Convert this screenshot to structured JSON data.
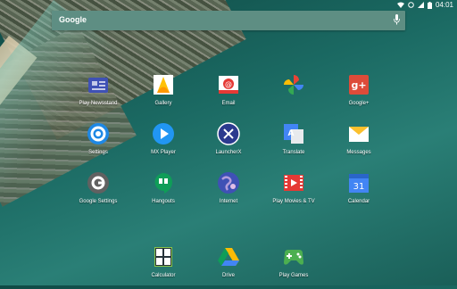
{
  "status_bar": {
    "time": "04:01"
  },
  "search": {
    "label": "Google"
  },
  "apps": [
    {
      "label": "Play Newsstand"
    },
    {
      "label": "Gallery"
    },
    {
      "label": "Email"
    },
    {
      "label": "Photos"
    },
    {
      "label": "Google+"
    },
    {
      "label": "Settings"
    },
    {
      "label": "MX Player"
    },
    {
      "label": "LauncherX"
    },
    {
      "label": "Translate"
    },
    {
      "label": "Messages"
    },
    {
      "label": "Google Settings"
    },
    {
      "label": "Hangouts"
    },
    {
      "label": "Internet"
    },
    {
      "label": "Play Movies & TV"
    },
    {
      "label": "Calendar"
    },
    {
      "label": "Calculator"
    },
    {
      "label": "Drive"
    },
    {
      "label": "Play Games"
    }
  ],
  "icon_text": {
    "email": "@",
    "gplus": "g+",
    "translate_a": "A",
    "calendar_day": "31"
  },
  "colors": {
    "search_bar": "#5e8e83",
    "wallpaper_sea": "#1b6a63"
  }
}
